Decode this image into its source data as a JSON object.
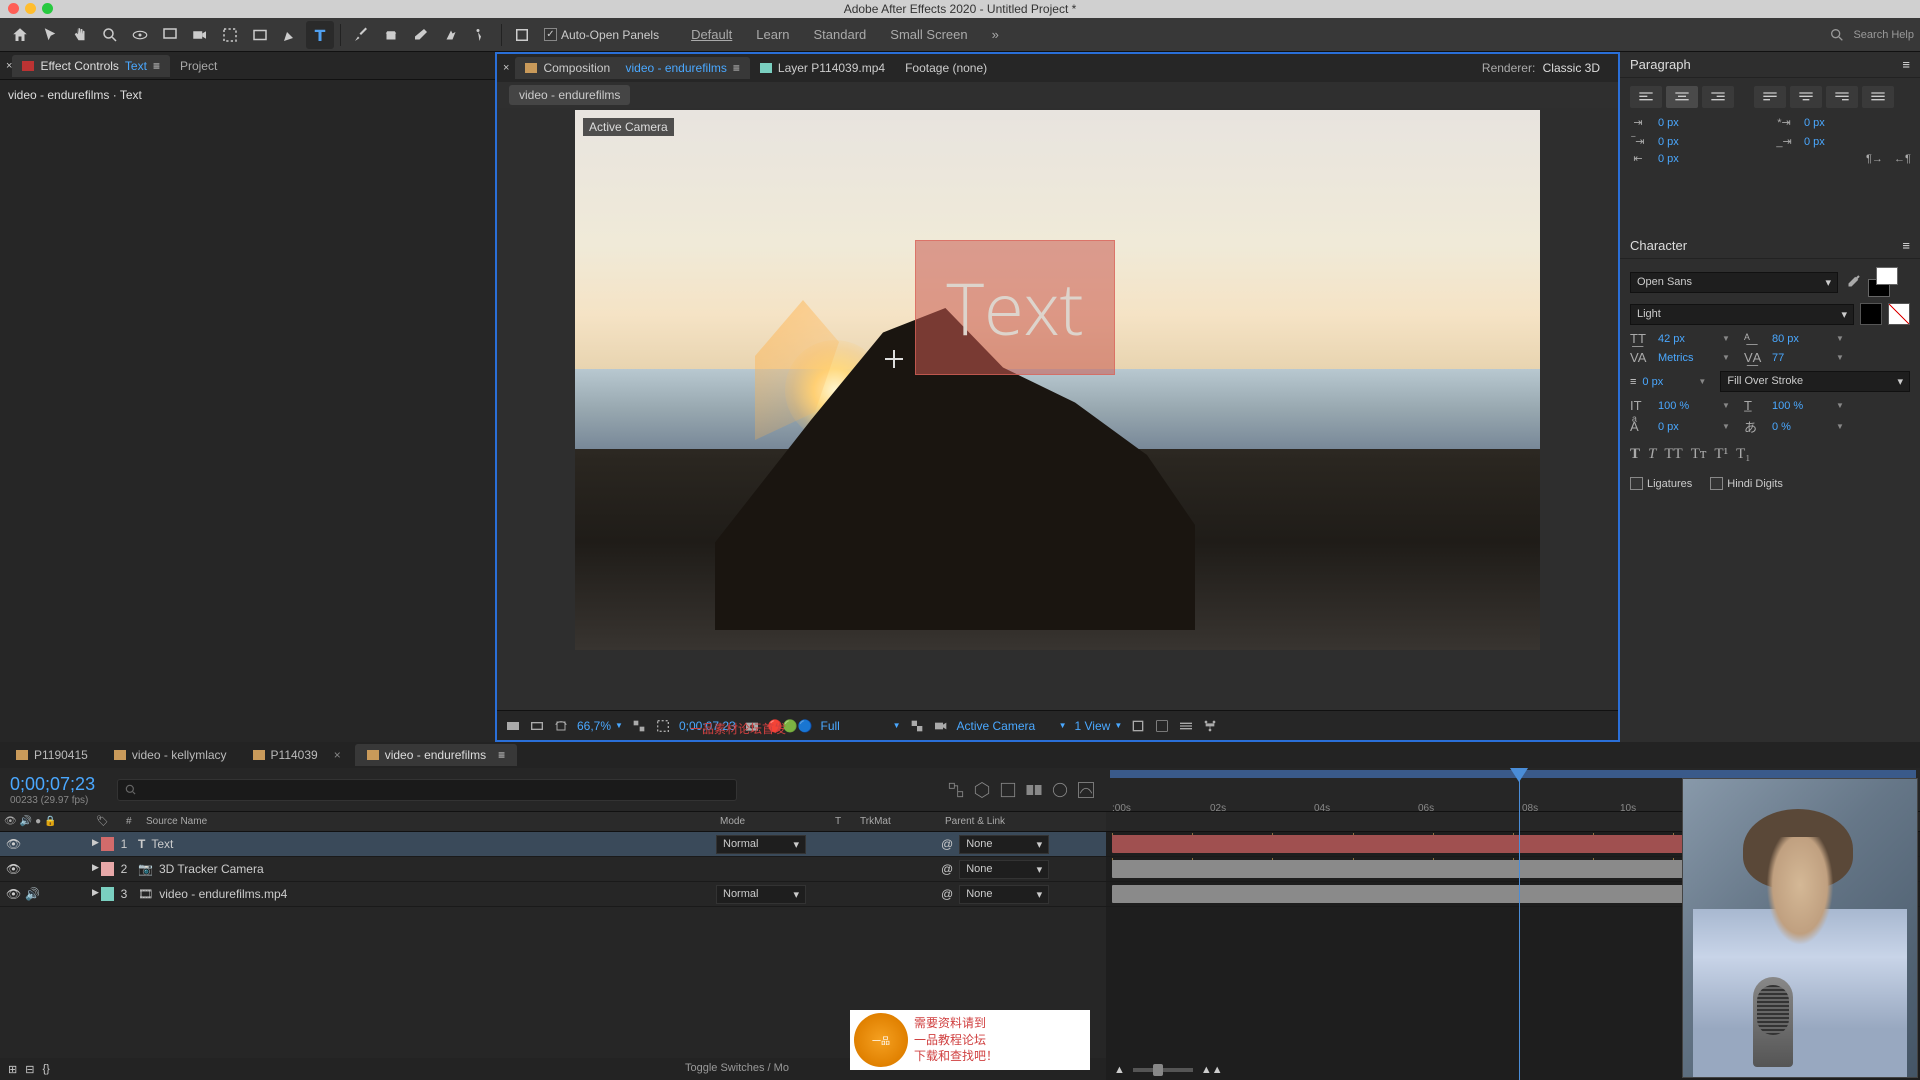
{
  "window_title": "Adobe After Effects 2020 - Untitled Project *",
  "toolbar": {
    "auto_open": "Auto-Open Panels",
    "workspaces": [
      "Default",
      "Learn",
      "Standard",
      "Small Screen"
    ],
    "search_placeholder": "Search Help"
  },
  "left_panel": {
    "tabs": {
      "effect_controls": "Effect Controls",
      "fx_target": "Text",
      "project": "Project"
    },
    "breadcrumb": "video - endurefilms · Text"
  },
  "composition": {
    "tab_label": "Composition",
    "tab_name": "video - endurefilms",
    "layer_tab": "Layer P114039.mp4",
    "footage_tab": "Footage (none)",
    "renderer_label": "Renderer:",
    "renderer_value": "Classic 3D",
    "crumb": "video - endurefilms",
    "camera_label": "Active Camera",
    "overlay_text": "Text"
  },
  "viewer_controls": {
    "zoom": "66,7%",
    "time": "0;00;07;23",
    "res": "Full",
    "camera": "Active Camera",
    "view": "1 View"
  },
  "paragraph": {
    "title": "Paragraph",
    "vals": {
      "indent_left": "0 px",
      "indent_right": "0 px",
      "indent_first": "0 px",
      "space_before": "0 px",
      "space_after": "0 px"
    }
  },
  "character": {
    "title": "Character",
    "font": "Open Sans",
    "style": "Light",
    "size": "42 px",
    "leading": "80 px",
    "kerning": "Metrics",
    "tracking": "77",
    "stroke_w": "0 px",
    "stroke_mode": "Fill Over Stroke",
    "vscale": "100 %",
    "hscale": "100 %",
    "baseline": "0 px",
    "tsume": "0 %",
    "ligatures": "Ligatures",
    "hindi": "Hindi Digits"
  },
  "timeline": {
    "tabs": [
      "P1190415",
      "video - kellymlacy",
      "P114039",
      "video - endurefilms"
    ],
    "timecode": "0;00;07;23",
    "timecode_sub": "00233 (29.97 fps)",
    "cols": {
      "num": "#",
      "source": "Source Name",
      "mode": "Mode",
      "t": "T",
      "trk": "TrkMat",
      "parent": "Parent & Link"
    },
    "layers": [
      {
        "num": "1",
        "name": "Text",
        "icon": "T",
        "mode": "Normal",
        "parent": "None",
        "color": "#d26b6b"
      },
      {
        "num": "2",
        "name": "3D Tracker Camera",
        "icon": "cam",
        "mode": "",
        "parent": "None",
        "color": "#e8a8a8"
      },
      {
        "num": "3",
        "name": "video - endurefilms.mp4",
        "icon": "vid",
        "mode": "Normal",
        "parent": "None",
        "color": "#7acfc0"
      }
    ],
    "toggle_label": "Toggle Switches / Mo",
    "ruler_marks": [
      ":00s",
      "02s",
      "04s",
      "06s",
      "08s",
      "10s"
    ]
  },
  "overlays": {
    "red_note": "一品素材论坛首发",
    "cn_lines": [
      "需要资料请到",
      "一品教程论坛",
      "下载和查找吧！"
    ]
  }
}
